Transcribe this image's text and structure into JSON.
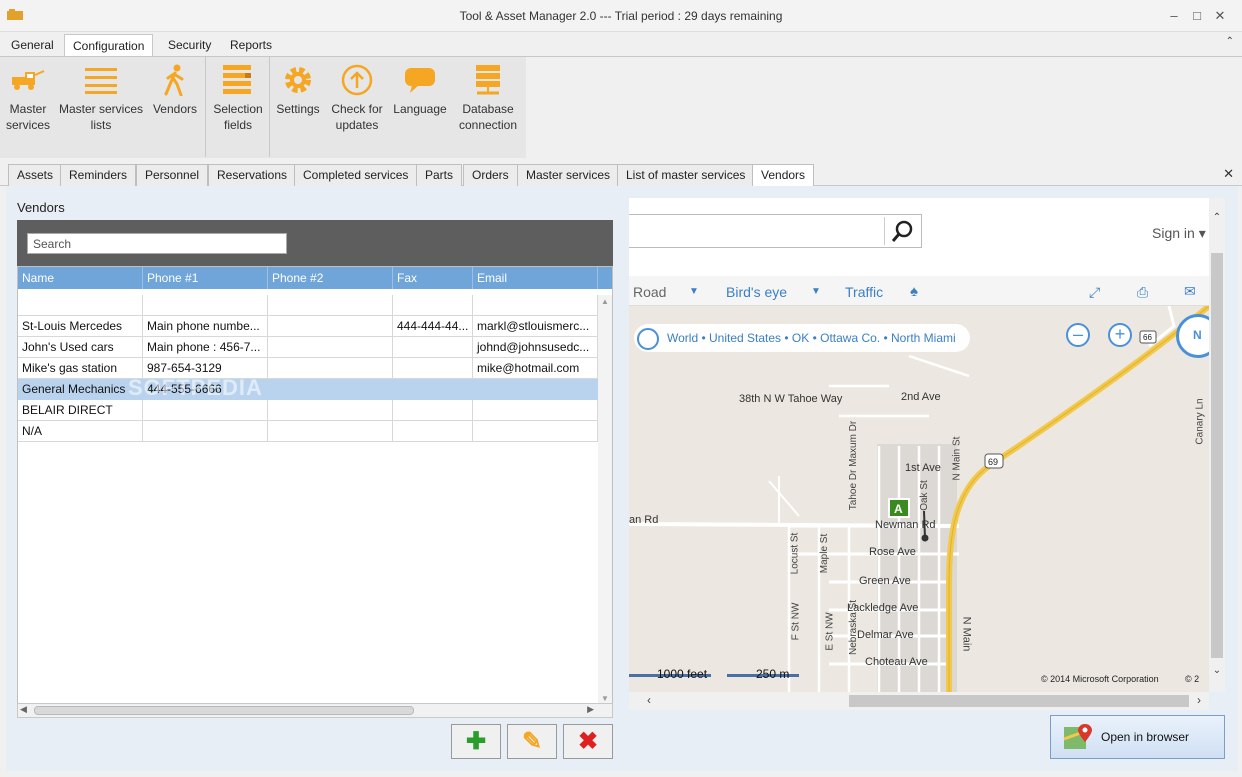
{
  "window": {
    "title": "Tool & Asset Manager 2.0 --- Trial period : 29 days remaining"
  },
  "menu": {
    "tabs": [
      "General",
      "Configuration",
      "Security",
      "Reports"
    ]
  },
  "ribbon": {
    "buttons": [
      {
        "label1": "Master",
        "label2": "services",
        "icon": "tow-truck-icon"
      },
      {
        "label1": "Master services",
        "label2": "lists",
        "icon": "list-icon"
      },
      {
        "label1": "Vendors",
        "label2": "",
        "icon": "walking-person-icon"
      },
      {
        "label1": "Selection",
        "label2": "fields",
        "icon": "fields-icon"
      },
      {
        "label1": "Settings",
        "label2": "",
        "icon": "gear-icon"
      },
      {
        "label1": "Check for",
        "label2": "updates",
        "icon": "up-arrow-icon"
      },
      {
        "label1": "Language",
        "label2": "",
        "icon": "speech-bubble-icon"
      },
      {
        "label1": "Database",
        "label2": "connection",
        "icon": "database-icon"
      }
    ],
    "accent": "#f5a623"
  },
  "tabs": [
    "Assets",
    "Reminders",
    "Personnel",
    "Reservations",
    "Completed services",
    "Parts",
    "Orders",
    "Master services",
    "List of master services",
    "Vendors"
  ],
  "vendors": {
    "title": "Vendors",
    "search_placeholder": "Search",
    "columns": [
      "Name",
      "Phone #1",
      "Phone #2",
      "Fax",
      "Email"
    ],
    "rows": [
      [
        "",
        "",
        "",
        "",
        ""
      ],
      [
        "St-Louis Mercedes",
        "Main phone numbe...",
        "",
        "444-444-44...",
        "markl@stlouismerc..."
      ],
      [
        "John's Used cars",
        "Main phone : 456-7...",
        "",
        "",
        "johnd@johnsusedc..."
      ],
      [
        "Mike's gas station",
        "987-654-3129",
        "",
        "",
        "mike@hotmail.com"
      ],
      [
        "General Mechanics",
        "444-555-6666",
        "",
        "",
        ""
      ],
      [
        "BELAIR DIRECT",
        "",
        "",
        "",
        ""
      ],
      [
        "N/A",
        "",
        "",
        "",
        ""
      ]
    ],
    "selected_row": 4,
    "watermark": "SOFTPEDIA"
  },
  "map": {
    "sign_in": "Sign in",
    "modes": [
      "Road",
      "Bird's eye",
      "Traffic"
    ],
    "breadcrumb": "World • United States • OK • Ottawa Co. • North Miami",
    "streets": [
      "38th N W Tahoe Way",
      "2nd Ave",
      "1st Ave",
      "Newman Rd",
      "Rose Ave",
      "Green Ave",
      "Lackledge Ave",
      "Delmar Ave",
      "Choteau Ave",
      "N Main",
      "N Main St",
      "Tahoe Dr Maxum Dr",
      "Locust St",
      "Maple St",
      "F St NW",
      "E St NW",
      "Nebraska St",
      "Oak St",
      "Canary Ln",
      "an Rd"
    ],
    "highway_labels": [
      "69",
      "66"
    ],
    "marker": "A",
    "scale": [
      "1000 feet",
      "250 m"
    ],
    "copyright": "© 2014 Microsoft Corporation",
    "copyright_tail": "© 2"
  },
  "open_browser": "Open in browser"
}
